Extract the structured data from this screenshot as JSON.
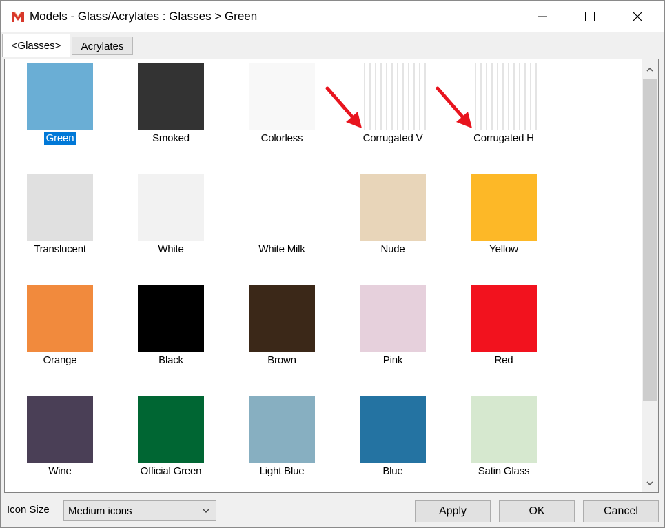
{
  "window": {
    "title": "Models - Glass/Acrylates :  Glasses > Green"
  },
  "tabs": [
    {
      "label": "<Glasses>",
      "active": true
    },
    {
      "label": "Acrylates",
      "active": false
    }
  ],
  "materials": [
    {
      "label": "Green",
      "color": "#6aaed5",
      "selected": true
    },
    {
      "label": "Smoked",
      "color": "#333333"
    },
    {
      "label": "Colorless",
      "color": "#f8f8f8"
    },
    {
      "label": "Corrugated V",
      "color": "#f4f4f4",
      "pattern": "vertical-stripes"
    },
    {
      "label": "Corrugated H",
      "color": "#f4f4f4",
      "pattern": "vertical-stripes"
    },
    {
      "label": "Translucent",
      "color": "#e0e0e0"
    },
    {
      "label": "White",
      "color": "#f2f2f2"
    },
    {
      "label": "White Milk",
      "color": "#ffffff"
    },
    {
      "label": "Nude",
      "color": "#e8d5b9"
    },
    {
      "label": "Yellow",
      "color": "#fdb827"
    },
    {
      "label": "Orange",
      "color": "#f18a3d"
    },
    {
      "label": "Black",
      "color": "#000000"
    },
    {
      "label": "Brown",
      "color": "#3b2818"
    },
    {
      "label": "Pink",
      "color": "#e6d0dc"
    },
    {
      "label": "Red",
      "color": "#f2121e"
    },
    {
      "label": "Wine",
      "color": "#4a3f56"
    },
    {
      "label": "Official Green",
      "color": "#006633"
    },
    {
      "label": "Light Blue",
      "color": "#87afc1"
    },
    {
      "label": "Blue",
      "color": "#2473a2"
    },
    {
      "label": "Satin Glass",
      "color": "#d6e8cf"
    }
  ],
  "footer": {
    "icon_size_label": "Icon Size",
    "icon_size_value": "Medium icons",
    "apply_label": "Apply",
    "ok_label": "OK",
    "cancel_label": "Cancel"
  },
  "colors": {
    "selection": "#0078d7",
    "annotation_arrow": "#e8141e"
  }
}
